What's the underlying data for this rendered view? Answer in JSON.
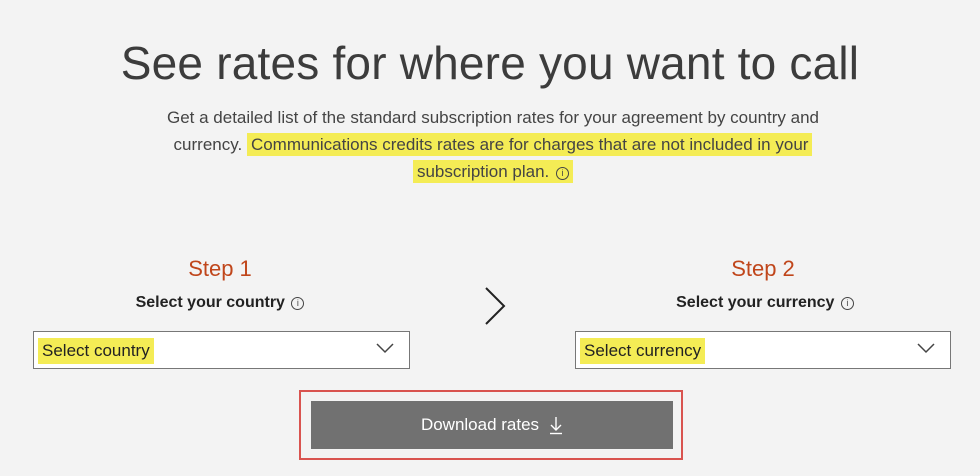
{
  "title": "See rates for where you want to call",
  "description": {
    "line1": "Get a detailed list of the standard subscription rates for your agreement by country and",
    "line2_prefix": "currency.",
    "highlight_line1": "Communications credits rates are for charges that are not included in your",
    "highlight_line2": "subscription plan.",
    "info_glyph": "i"
  },
  "step1": {
    "title": "Step 1",
    "subtitle": "Select your country",
    "select_value": "Select country",
    "info_glyph": "i"
  },
  "step2": {
    "title": "Step 2",
    "subtitle": "Select your currency",
    "select_value": "Select currency",
    "info_glyph": "i"
  },
  "download": {
    "label": "Download rates"
  },
  "colors": {
    "highlight": "#f4ec55",
    "step_title": "#c0461b",
    "button_bg": "#717171",
    "callout_border": "#d9534f"
  },
  "icons": {
    "separator": "chevron-right-icon",
    "dropdown": "chevron-down-icon",
    "download": "download-arrow-icon",
    "info": "info-circle-icon"
  }
}
